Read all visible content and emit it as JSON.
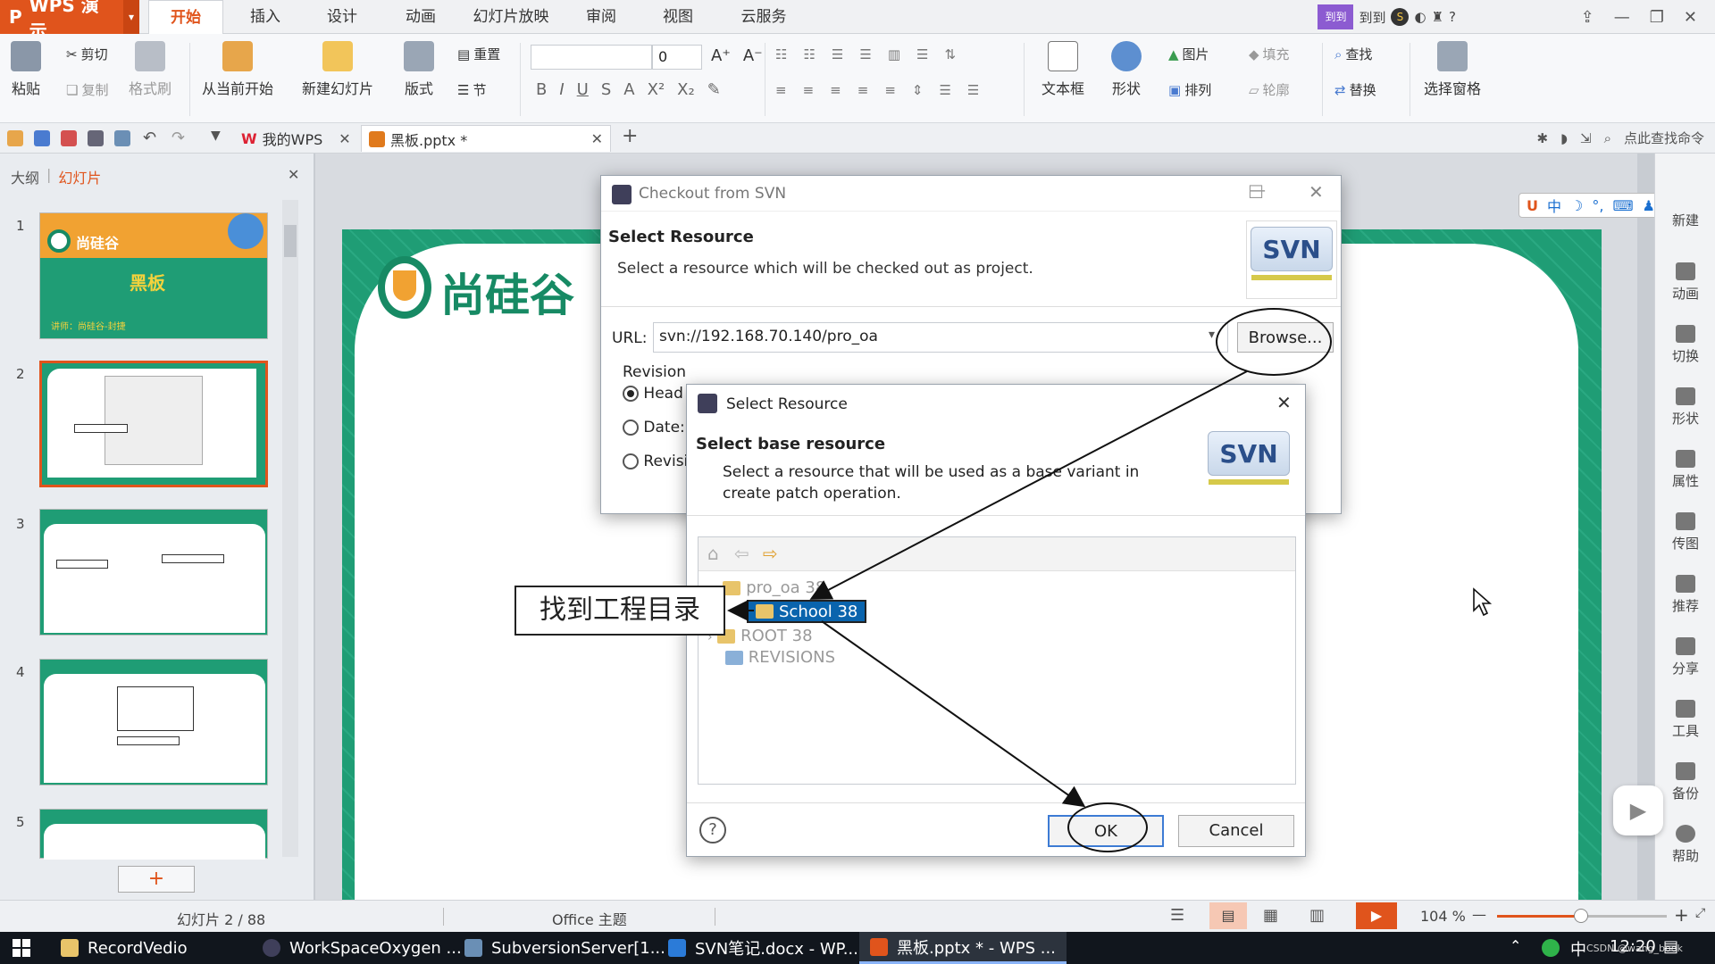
{
  "app": {
    "name": "WPS 演示",
    "menu_tabs": [
      "开始",
      "插入",
      "设计",
      "动画",
      "幻灯片放映",
      "审阅",
      "视图",
      "云服务"
    ],
    "account_label": "到到",
    "account_badge": "S",
    "help_label": "?"
  },
  "ribbon": {
    "paste": "粘贴",
    "cut": "剪切",
    "copy": "复制",
    "format_painter": "格式刷",
    "from_current": "从当前开始",
    "new_slide": "新建幻灯片",
    "layout": "版式",
    "reset": "重置",
    "section": "节",
    "font_size": "0",
    "textbox": "文本框",
    "shape": "形状",
    "picture": "图片",
    "arrange": "排列",
    "fill": "填充",
    "outline": "轮廓",
    "find": "查找",
    "replace": "替换",
    "selection_pane": "选择窗格"
  },
  "quickbar": {
    "tab_home": "我的WPS",
    "tab_doc": "黑板.pptx *",
    "command_search": "点此查找命令"
  },
  "left_panel": {
    "tab_outline": "大纲",
    "tab_slides": "幻灯片",
    "slide_numbers": [
      "1",
      "2",
      "3",
      "4",
      "5"
    ],
    "slide1_brand": "尚硅谷",
    "slide1_title": "黑板",
    "slide1_footer": "讲师：尚硅谷-封捷",
    "add_slide": "+"
  },
  "slide": {
    "logo_text": "尚硅谷"
  },
  "right_sidebar": [
    "新建",
    "动画",
    "切换",
    "形状",
    "属性",
    "传图",
    "推荐",
    "分享",
    "工具",
    "备份",
    "帮助"
  ],
  "svn_checkout_dialog": {
    "title": "Checkout from SVN",
    "heading": "Select Resource",
    "description": "Select a resource which will be checked out as project.",
    "url_label": "URL:",
    "url_value": "svn://192.168.70.140/pro_oa",
    "browse_button": "Browse...",
    "revision_label": "Revision",
    "radio_head": "Head",
    "radio_date": "Date:",
    "radio_revision": "Revisi"
  },
  "select_resource_dialog": {
    "title": "Select Resource",
    "heading": "Select base resource",
    "description_line1": "Select a resource that will be used as a base variant in",
    "description_line2": "create patch operation.",
    "tree": [
      {
        "label": "pro_oa 38",
        "level": 0,
        "selected": false
      },
      {
        "label": "School 38",
        "level": 1,
        "selected": true
      },
      {
        "label": "ROOT 38",
        "level": 0,
        "selected": false
      },
      {
        "label": "REVISIONS",
        "level": 0,
        "selected": false
      }
    ],
    "ok_button": "OK",
    "cancel_button": "Cancel",
    "help_symbol": "?"
  },
  "svn_logo_text": "SVN",
  "annotation": {
    "callout_text": "找到工程目录"
  },
  "status_bar": {
    "slide_counter": "幻灯片 2 / 88",
    "theme": "Office 主题",
    "zoom": "104 %"
  },
  "taskbar": {
    "items": [
      "RecordVedio",
      "WorkSpaceOxygen ...",
      "SubversionServer[1...",
      "SVN笔记.docx - WP...",
      "黑板.pptx * - WPS ..."
    ],
    "clock": "12:20",
    "ime": "中",
    "watermark": "CSDN @wang_book"
  },
  "colors": {
    "wps_orange": "#e0541c",
    "slide_green": "#1f9d75",
    "selection_blue": "#0a64ad"
  }
}
